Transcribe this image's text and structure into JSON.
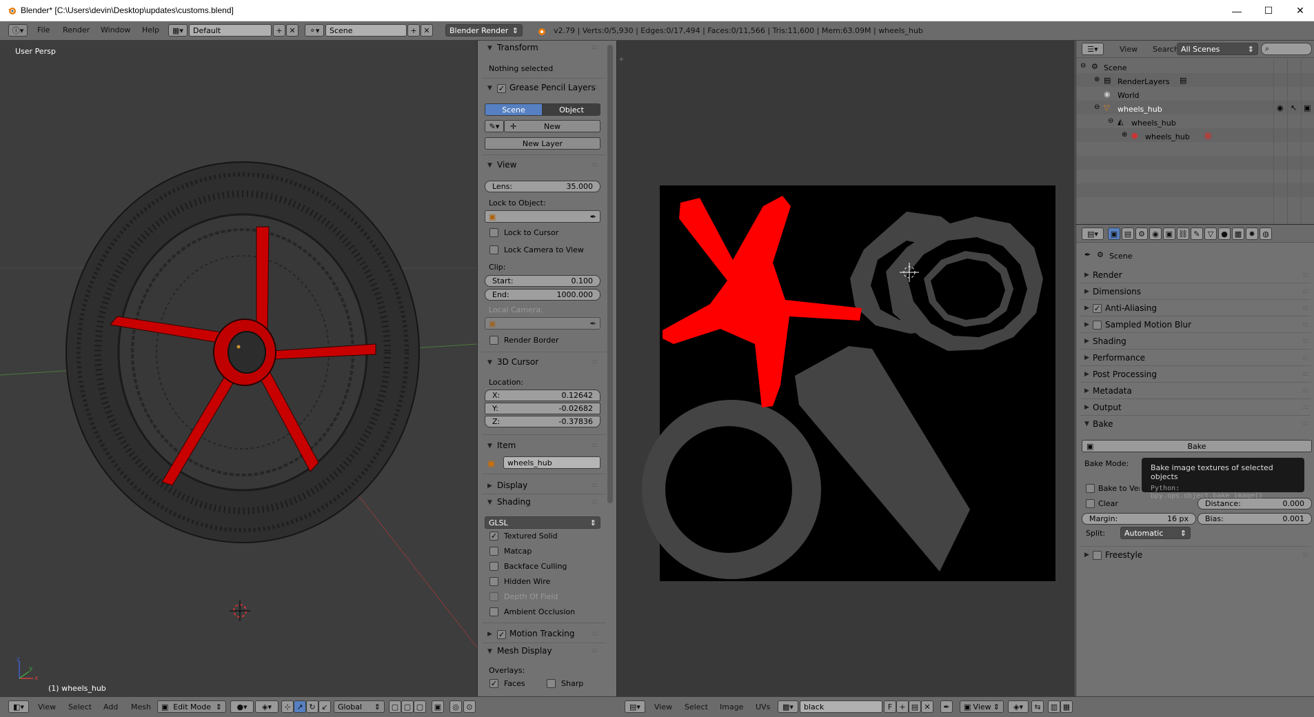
{
  "window": {
    "title": "Blender* [C:\\Users\\devin\\Desktop\\updates\\customs.blend]",
    "minimize": "—",
    "maximize": "☐",
    "close": "✕"
  },
  "topbar": {
    "menus": [
      "File",
      "Render",
      "Window",
      "Help"
    ],
    "layout": "Default",
    "scene": "Scene",
    "engine": "Blender Render",
    "stats": "v2.79 | Verts:0/5,930 | Edges:0/17,494 | Faces:0/11,566 | Tris:11,600 | Mem:63.09M | wheels_hub"
  },
  "viewport": {
    "label": "User Persp",
    "object": "(1) wheels_hub",
    "axis_x": "x",
    "axis_y": "y",
    "axis_z": "z"
  },
  "npanel": {
    "transform": {
      "header": "Transform",
      "empty": "Nothing selected"
    },
    "grease": {
      "header": "Grease Pencil Layers",
      "scene": "Scene",
      "object": "Object",
      "new": "New",
      "new_layer": "New Layer"
    },
    "view": {
      "header": "View",
      "lens_label": "Lens:",
      "lens_value": "35.000",
      "lock_to_object": "Lock to Object:",
      "lock_to_cursor": "Lock to Cursor",
      "lock_camera": "Lock Camera to View",
      "clip": "Clip:",
      "start_label": "Start:",
      "start_value": "0.100",
      "end_label": "End:",
      "end_value": "1000.000",
      "local_camera": "Local Camera:",
      "render_border": "Render Border"
    },
    "cursor": {
      "header": "3D Cursor",
      "location": "Location:",
      "x_label": "X:",
      "x_value": "0.12642",
      "y_label": "Y:",
      "y_value": "-0.02682",
      "z_label": "Z:",
      "z_value": "-0.37836"
    },
    "item": {
      "header": "Item",
      "name": "wheels_hub"
    },
    "display": {
      "header": "Display"
    },
    "shading": {
      "header": "Shading",
      "mode": "GLSL",
      "textured_solid": "Textured Solid",
      "matcap": "Matcap",
      "backface": "Backface Culling",
      "hidden_wire": "Hidden Wire",
      "dof": "Depth Of Field",
      "ao": "Ambient Occlusion"
    },
    "motion": {
      "header": "Motion Tracking"
    },
    "mesh": {
      "header": "Mesh Display",
      "overlays": "Overlays:",
      "faces": "Faces",
      "sharp": "Sharp"
    }
  },
  "outliner": {
    "menus": [
      "View",
      "Search"
    ],
    "filter": "All Scenes",
    "rows": [
      "Scene",
      "RenderLayers",
      "World",
      "wheels_hub",
      "wheels_hub",
      "wheels_hub"
    ]
  },
  "props": {
    "context": "Scene",
    "panels": [
      "Render",
      "Dimensions",
      "Anti-Aliasing",
      "Sampled Motion Blur",
      "Shading",
      "Performance",
      "Post Processing",
      "Metadata",
      "Output",
      "Bake"
    ],
    "bake": {
      "button": "Bake",
      "mode_label": "Bake Mode:",
      "to_vertex": "Bake to Vertex",
      "clear": "Clear",
      "distance_label": "Distance:",
      "distance_value": "0.000",
      "margin_label": "Margin:",
      "margin_value": "16 px",
      "bias_label": "Bias:",
      "bias_value": "0.001",
      "split_label": "Split:",
      "split_value": "Automatic"
    },
    "freestyle": "Freestyle"
  },
  "tooltip": {
    "text": "Bake image textures of selected objects",
    "python": "Python: bpy.ops.object.bake_image()"
  },
  "bottom3d": {
    "menus": [
      "View",
      "Select",
      "Add",
      "Mesh"
    ],
    "mode": "Edit Mode",
    "orientation": "Global"
  },
  "bottomimg": {
    "menus": [
      "View",
      "Select",
      "Image",
      "UVs"
    ],
    "image": "black",
    "f": "F",
    "view": "View"
  },
  "colors": {
    "uv_red": "#ff0000",
    "uv_gray": "#444444",
    "accent_blue": "#5680c2"
  }
}
